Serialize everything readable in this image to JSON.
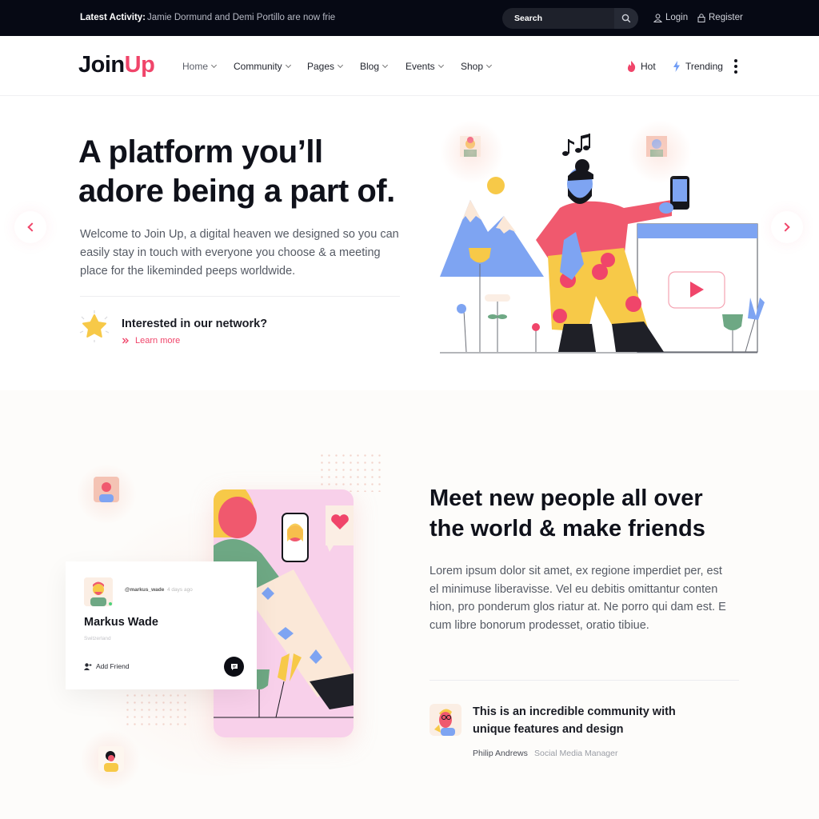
{
  "topbar": {
    "activity_label": "Latest Activity:",
    "activity_text": "Jamie Dormund and Demi Portillo are now frie",
    "search_placeholder": "Search",
    "login_label": "Login",
    "register_label": "Register"
  },
  "nav": {
    "logo_part1": "Join",
    "logo_part2": "Up",
    "items": [
      {
        "label": "Home"
      },
      {
        "label": "Community"
      },
      {
        "label": "Pages"
      },
      {
        "label": "Blog"
      },
      {
        "label": "Events"
      },
      {
        "label": "Shop"
      }
    ],
    "hot_label": "Hot",
    "trending_label": "Trending"
  },
  "hero": {
    "title_line1": "A platform you’ll",
    "title_line2": "adore being a part of.",
    "description": "Welcome to Join Up, a digital heaven we designed so you can easily stay in touch with everyone you choose & a meeting place for the likeminded peeps worldwide.",
    "cta_question": "Interested in our network?",
    "cta_link": "Learn more"
  },
  "section2": {
    "title_line1": "Meet new people all over",
    "title_line2": "the world & make friends",
    "description": "Lorem ipsum dolor sit amet, ex regione imperdiet per, est el minimuse liberavisse. Vel eu debitis omittantur conten hion, pro ponderum glos riatur at. Ne porro qui dam est. E cum libre bonorum prodesset, oratio tibiue.",
    "quote_line1": "This is an incredible community with",
    "quote_line2": "unique features and design",
    "quote_author": "Philip Andrews",
    "quote_role": "Social Media Manager",
    "profile": {
      "handle": "@markus_wade",
      "time": "4 days ago",
      "name": "Markus Wade",
      "location": "Switzerland",
      "add_friend_label": "Add Friend"
    }
  },
  "colors": {
    "accent": "#f0456a",
    "dark": "#060914",
    "trending": "#6f9cf5"
  }
}
